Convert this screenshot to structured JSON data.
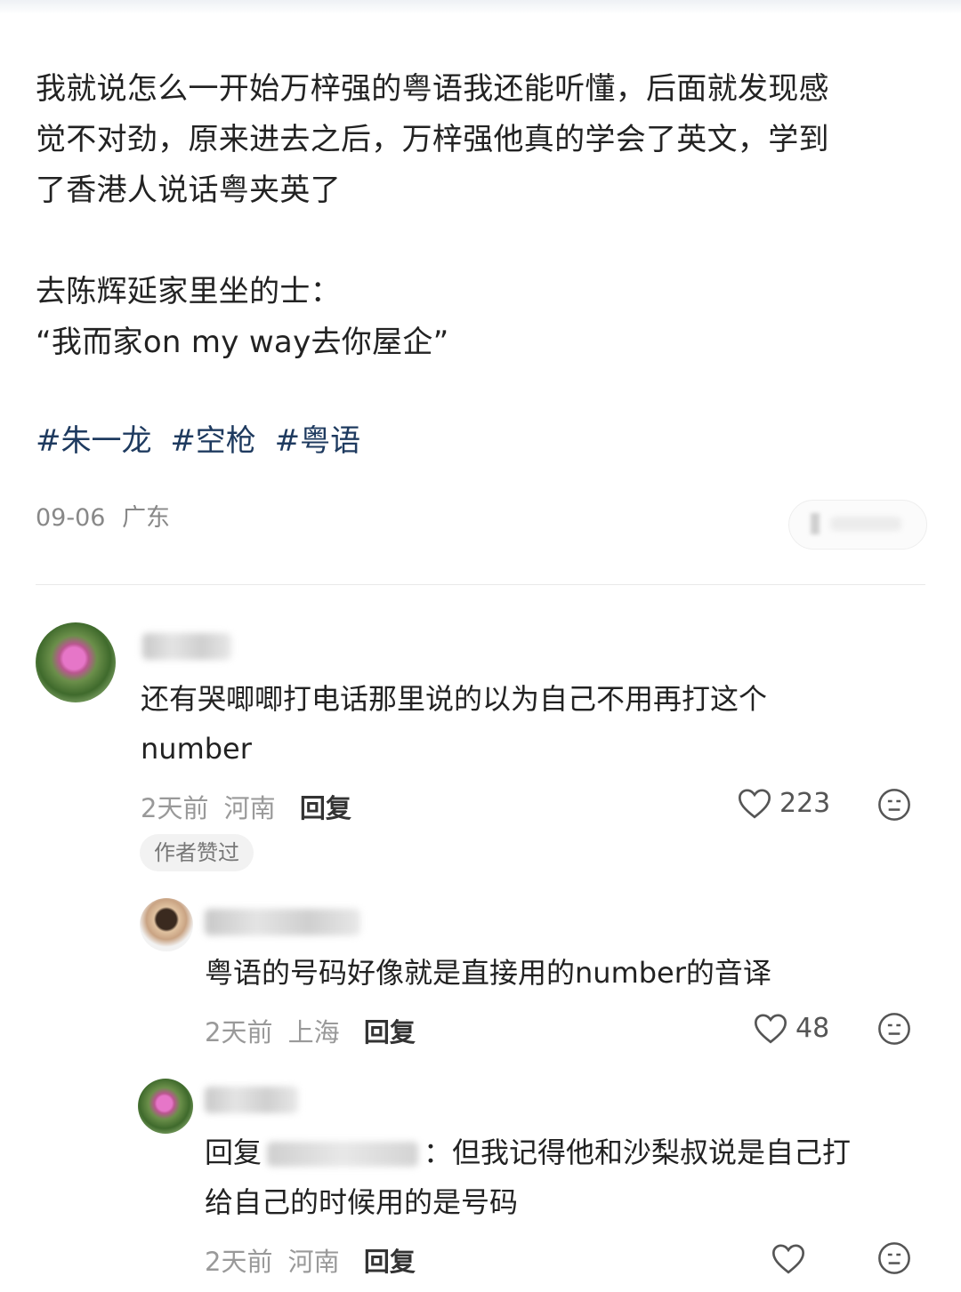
{
  "post": {
    "paragraph1": [
      "我就说怎么一开始万梓强的粤语我还能听懂，后面就发现感",
      "觉不对劲，原来进去之后，万梓强他真的学会了英文，学到",
      "了香港人说话粤夹英了"
    ],
    "paragraph2": [
      "去陈辉延家里坐的士：",
      "“我而家on my way去你屋企”"
    ],
    "tags": [
      "#朱一龙",
      "#空枪",
      "#粤语"
    ],
    "date": "09-06",
    "location": "广东"
  },
  "comments": [
    {
      "text_lines": [
        "还有哭唧唧打电话那里说的以为自己不用再打这个",
        "number"
      ],
      "time": "2天前",
      "location": "河南",
      "reply_label": "回复",
      "likes": "223",
      "badge": "作者赞过"
    },
    {
      "text": "粤语的号码好像就是直接用的number的音译",
      "time": "2天前",
      "location": "上海",
      "reply_label": "回复",
      "likes": "48"
    },
    {
      "reply_prefix": "回复",
      "text_line1": "：但我记得他和沙梨叔说是自己打",
      "text_line2": "给自己的时候用的是号码",
      "time": "2天前",
      "location": "河南",
      "reply_label": "回复"
    }
  ]
}
